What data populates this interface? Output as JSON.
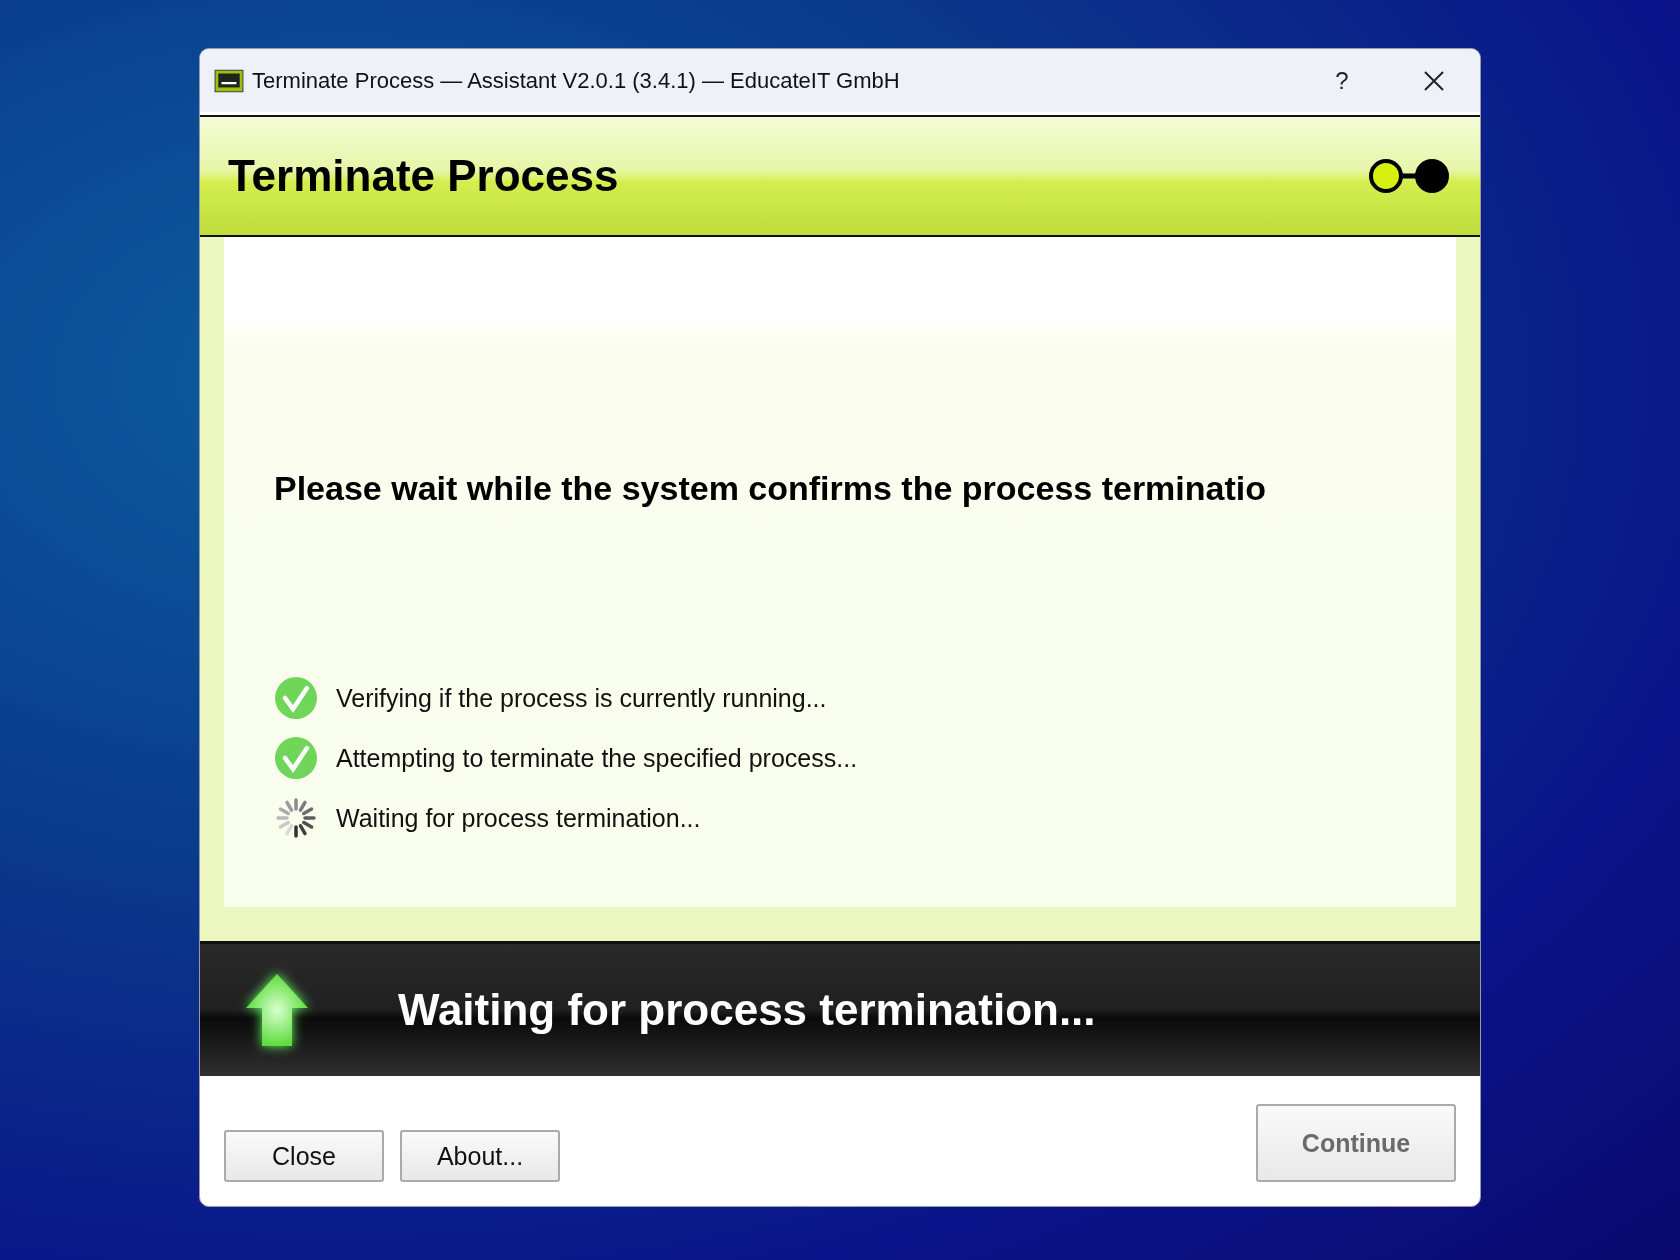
{
  "window": {
    "title": "Terminate Process — Assistant V2.0.1 (3.4.1) — EducateIT GmbH",
    "help": "?"
  },
  "header": {
    "title": "Terminate Process",
    "steps": [
      {
        "selected": true
      },
      {
        "selected": false
      }
    ]
  },
  "message": "Please wait while the system confirms the process terminatio",
  "tasks": [
    {
      "kind": "done",
      "label": "Verifying if the process is currently running..."
    },
    {
      "kind": "done",
      "label": "Attempting to terminate the specified process..."
    },
    {
      "kind": "running",
      "label": "Waiting for process termination..."
    }
  ],
  "status_bar": {
    "text": "Waiting for process termination..."
  },
  "buttons": [
    {
      "label": "Close",
      "disabled": false
    },
    {
      "label": "About...",
      "disabled": false
    }
  ],
  "continue_button": {
    "label": "Continue",
    "disabled": true
  }
}
